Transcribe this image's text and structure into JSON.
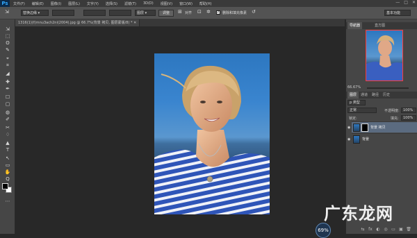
{
  "app": {
    "logo": "Ps"
  },
  "menu": [
    "文件(F)",
    "编辑(E)",
    "图像(I)",
    "图层(L)",
    "文字(Y)",
    "选择(S)",
    "滤镜(T)",
    "3D(D)",
    "视图(V)",
    "窗口(W)",
    "帮助(H)"
  ],
  "window_controls": [
    "—",
    "□",
    "✕"
  ],
  "options": {
    "mode": "替换边缘 ▾",
    "field2": "",
    "field3": "",
    "field4": "",
    "sample": "图层 ▾",
    "select_btn": "调整",
    "align_label": "对齐",
    "checkbox_label": "删除和填充像素",
    "workspace": "基本功能"
  },
  "document_tab": "1316(1)(f)rnnu3ach2ni(2004).jpg @ 66.7%(背景 拷贝, 图层蒙版/8) * ✕",
  "tools": [
    "⇲",
    "⬚",
    "ʘ",
    "✎",
    "⌖",
    "⌗",
    "◢",
    "✚",
    "✒",
    "☐",
    "▢",
    "◍",
    "✐",
    "✂",
    "♢",
    "▲",
    "T",
    "↖",
    "▭",
    "✋",
    "Q",
    "⋯"
  ],
  "navigator": {
    "tabs": [
      "导航器",
      "直方图"
    ],
    "zoom": "66.67%"
  },
  "layers_panel": {
    "tabs": [
      "图层",
      "通道",
      "路径",
      "历史"
    ],
    "filter": "p 类型",
    "blend_mode": "正常",
    "opacity_label": "不透明度:",
    "opacity_value": "100%",
    "lock_label": "锁定:",
    "fill_label": "填充:",
    "fill_value": "100%",
    "layers": [
      {
        "name": "背景 拷贝",
        "selected": true,
        "has_mask": true
      },
      {
        "name": "背景",
        "selected": false,
        "has_mask": false
      }
    ]
  },
  "status": {
    "zoom_indicator": "69%"
  },
  "watermark": "广东龙网",
  "panel_bottom_icons": [
    "⇆",
    "fx",
    "◐",
    "◎",
    "▭",
    "▣",
    "🗑"
  ]
}
